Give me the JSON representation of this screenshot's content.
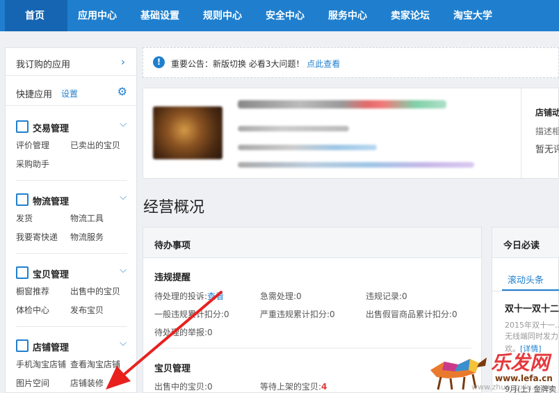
{
  "nav": {
    "items": [
      "首页",
      "应用中心",
      "基础设置",
      "规则中心",
      "安全中心",
      "服务中心",
      "卖家论坛",
      "淘宝大学"
    ]
  },
  "sidebar": {
    "subscribed_apps": "我订购的应用",
    "quick_apps": "快捷应用",
    "settings_link": "设置",
    "groups": [
      {
        "title": "交易管理",
        "links": [
          "评价管理",
          "已卖出的宝贝",
          "采购助手"
        ]
      },
      {
        "title": "物流管理",
        "links": [
          "发货",
          "物流工具",
          "我要寄快递",
          "物流服务"
        ]
      },
      {
        "title": "宝贝管理",
        "links": [
          "橱窗推荐",
          "出售中的宝贝",
          "体检中心",
          "发布宝贝"
        ]
      },
      {
        "title": "店铺管理",
        "links": [
          "手机淘宝店铺",
          "查看淘宝店铺",
          "图片空间",
          "店铺装修"
        ]
      }
    ]
  },
  "notice": {
    "text": "重要公告：新版切换 必看3大问题！",
    "link": "点此查看"
  },
  "shop": {
    "side_title": "店铺动",
    "side_sub1": "描述相",
    "side_sub2": "暂无评"
  },
  "overview_title": "经营概况",
  "todo": {
    "header": "待办事项",
    "violation": {
      "title": "违规提醒",
      "items": [
        {
          "label": "待处理的投诉:",
          "value": "查看"
        },
        {
          "label": "急需处理:",
          "value": "0"
        },
        {
          "label": "违规记录:",
          "value": "0"
        },
        {
          "label": "一般违规累计扣分:",
          "value": "0"
        },
        {
          "label": "严重违规累计扣分:",
          "value": "0"
        },
        {
          "label": "出售假冒商品累计扣分:",
          "value": "0"
        },
        {
          "label": "待处理的举报:",
          "value": "0"
        }
      ]
    },
    "goods": {
      "title": "宝贝管理",
      "items": [
        {
          "label": "出售中的宝贝:",
          "value": "0"
        },
        {
          "label": "等待上架的宝贝:",
          "value": "4"
        }
      ]
    }
  },
  "today": {
    "header": "今日必读",
    "tab": "滚动头条",
    "headline": "双十一双十二",
    "line1": "2015年双十一...",
    "line2": "无线端同时发力",
    "line3_prefix": "欢。",
    "line3_link": "[详情]",
    "line4": "9月(上) 金牌卖"
  },
  "watermark": {
    "logo": "乐发网",
    "url": "www.lefa.cn",
    "url2": "www.zhuangxiu.com"
  },
  "colors": {
    "primary": "#1f7fce",
    "nav_active": "#1565b2",
    "alert": "#e4393c"
  }
}
